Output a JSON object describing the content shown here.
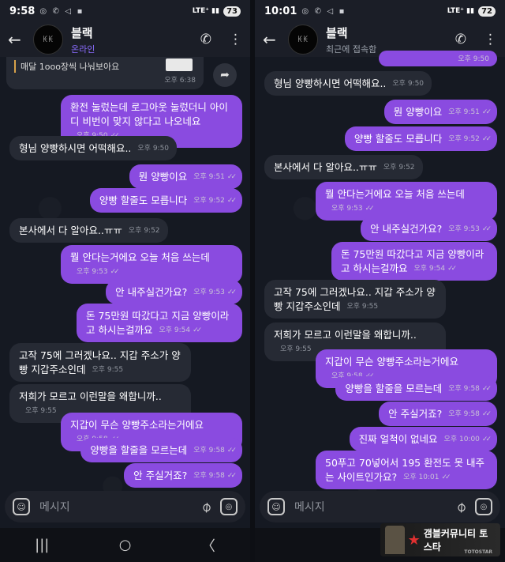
{
  "left": {
    "status": {
      "time": "9:58",
      "icons": "◎ ✆ ◁ ▪",
      "signal": "LTE⁺ ▮▮",
      "battery": "73"
    },
    "header": {
      "name": "블랙",
      "status": "온라인",
      "status_color": "#8b6cff",
      "avatar_text": "ꀘꀘ"
    },
    "preview": {
      "text": "매달 1ooo장씩 나눠보아요",
      "meta": "오후 6:38"
    },
    "messages": [
      {
        "dir": "out",
        "text": "환전 눌렀는데 로그아웃 눌렀더니 아이디 비번이 맞지 않다고 나오네요",
        "time": "오후 9:50"
      },
      {
        "dir": "in",
        "text": "형님 양빵하시면 어떡해요..",
        "time": "오후 9:50"
      },
      {
        "dir": "out",
        "text": "뭔 양빵이요",
        "time": "오후 9:51"
      },
      {
        "dir": "out",
        "text": "양빵 할줄도 모릅니다",
        "time": "오후 9:52"
      },
      {
        "dir": "in",
        "text": "본사에서 다 알아요..ㅠㅠ",
        "time": "오후 9:52"
      },
      {
        "dir": "out",
        "text": "뭘 안다는거에요 오늘 처음 쓰는데",
        "time": "오후 9:53"
      },
      {
        "dir": "out",
        "text": "안 내주실건가요?",
        "time": "오후 9:53"
      },
      {
        "dir": "out",
        "text": "돈 75만원 따갔다고 지금 양빵이라고 하시는걸까요",
        "time": "오후 9:54"
      },
      {
        "dir": "in",
        "text": "고작 75에 그러겠나요.. 지갑 주소가 양빵 지갑주소인데",
        "time": "오후 9:55"
      },
      {
        "dir": "in",
        "text": "저희가 모르고 이런말을 왜합니까..",
        "time": "오후 9:55"
      },
      {
        "dir": "out",
        "text": "지갑이 무슨 양빵주소라는거에요",
        "time": "오후 9:58"
      },
      {
        "dir": "out",
        "text": "양빵을 할줄을 모르는데",
        "time": "오후 9:58"
      },
      {
        "dir": "out",
        "text": "안 주실거죠?",
        "time": "오후 9:58"
      }
    ],
    "input": {
      "placeholder": "메시지"
    }
  },
  "right": {
    "status": {
      "time": "10:01",
      "icons": "◎ ✆ ◁ ▪",
      "signal": "LTE⁺ ▮▮",
      "battery": "72"
    },
    "header": {
      "name": "블랙",
      "status": "최근에 접속함",
      "status_color": "#9aa0aa",
      "avatar_text": "ꀘꀘ"
    },
    "top_clip": {
      "time": "오후 9:50"
    },
    "messages": [
      {
        "dir": "in",
        "text": "형님 양빵하시면 어떡해요..",
        "time": "오후 9:50"
      },
      {
        "dir": "out",
        "text": "뭔 양빵이요",
        "time": "오후 9:51"
      },
      {
        "dir": "out",
        "text": "양빵 할줄도 모릅니다",
        "time": "오후 9:52"
      },
      {
        "dir": "in",
        "text": "본사에서 다 알아요..ㅠㅠ",
        "time": "오후 9:52"
      },
      {
        "dir": "out",
        "text": "뭘 안다는거에요 오늘 처음 쓰는데",
        "time": "오후 9:53"
      },
      {
        "dir": "out",
        "text": "안 내주실건가요?",
        "time": "오후 9:53"
      },
      {
        "dir": "out",
        "text": "돈 75만원 따갔다고 지금 양빵이라고 하시는걸까요",
        "time": "오후 9:54"
      },
      {
        "dir": "in",
        "text": "고작 75에 그러겠나요.. 지갑 주소가 양빵 지갑주소인데",
        "time": "오후 9:55"
      },
      {
        "dir": "in",
        "text": "저희가 모르고 이런말을 왜합니까..",
        "time": "오후 9:55"
      },
      {
        "dir": "out",
        "text": "지갑이 무슨 양빵주소라는거에요",
        "time": "오후 9:58"
      },
      {
        "dir": "out",
        "text": "양빵을 할줄을 모르는데",
        "time": "오후 9:58"
      },
      {
        "dir": "out",
        "text": "안 주실거죠?",
        "time": "오후 9:58"
      },
      {
        "dir": "out",
        "text": "진짜 얼척이 없네요",
        "time": "오후 10:00"
      },
      {
        "dir": "out",
        "text": "50푸고 70넣어서 195 환전도 못 내주는 사이트인가요?",
        "time": "오후 10:01"
      }
    ],
    "input": {
      "placeholder": "메시지"
    }
  },
  "nav": {
    "recent": "|||",
    "home": "○",
    "back": "〈"
  },
  "watermark": {
    "text": "갬블커뮤니티 토스타",
    "sub": "TOTOSTAR"
  },
  "colors": {
    "outgoing": "#8a4be0",
    "incoming": "#262a34"
  }
}
